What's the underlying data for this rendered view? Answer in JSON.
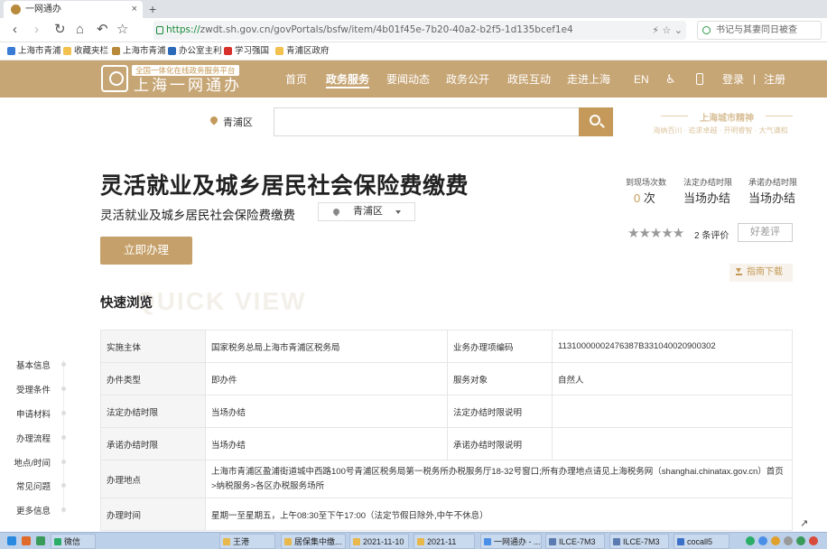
{
  "browser": {
    "tab_title": "一网通办",
    "tab_close": "×",
    "new_tab": "+",
    "url_scheme": "https://",
    "url_rest": "zwdt.sh.gov.cn/govPortals/bsfw/item/4b01f45e-7b20-40a2-b2f5-1d135bcef1e4",
    "url_right_icons": "⚡ ☆ ⌄",
    "search_placeholder": "书记与其妻同日被查",
    "bookmarks": [
      {
        "label": "上海市青浦",
        "color": "#3a7bd5"
      },
      {
        "label": "收藏夹栏",
        "color": "#f2c14e"
      },
      {
        "label": "上海市青浦",
        "color": "#b88a3c"
      },
      {
        "label": "办公室主利",
        "color": "#2a6ab8"
      },
      {
        "label": "学习强国",
        "color": "#d8302a"
      },
      {
        "label": "青浦区政府",
        "color": "#f2c14e"
      }
    ],
    "nav_back": "‹",
    "nav_forward": "›",
    "nav_reload": "↻",
    "nav_home": "⌂",
    "nav_undo": "↶",
    "nav_star": "☆"
  },
  "site": {
    "logo_tag": "全国一体化在线政务服务平台",
    "logo_name": "上海一网通办",
    "menu": [
      {
        "label": "首页",
        "active": false
      },
      {
        "label": "政务服务",
        "active": true
      },
      {
        "label": "要闻动态",
        "active": false
      },
      {
        "label": "政务公开",
        "active": false
      },
      {
        "label": "政民互动",
        "active": false
      },
      {
        "label": "走进上海",
        "active": false
      }
    ],
    "lang": "EN",
    "accessibility_icon": "♿",
    "login": "登录",
    "separator": "|",
    "register": "注册",
    "brand_color": "#c7a676",
    "accent_color": "#c49a56"
  },
  "search": {
    "location": "青浦区",
    "placeholder": "",
    "promo_title": "上海城市精神",
    "promo_sub": "海纳百川 · 追求卓越 · 开明睿智 · 大气谦和"
  },
  "item": {
    "title": "灵活就业及城乡居民社会保险费缴费",
    "subtitle": "灵活就业及城乡居民社会保险费缴费",
    "district": "青浦区",
    "stats": [
      {
        "label": "到现场次数",
        "num": "0",
        "unit": "次"
      },
      {
        "label": "法定办结时限",
        "value": "当场办结"
      },
      {
        "label": "承诺办结时限",
        "value": "当场办结"
      }
    ],
    "stars": "★★★★★",
    "rating_fraction": 1.0,
    "review_count": "2 条评价",
    "review_button": "好差评",
    "apply_button": "立即办理",
    "guide_button": "指南下载",
    "watermark": "QUICK VIEW",
    "quick_title": "快速浏览"
  },
  "side_nav": [
    "基本信息",
    "受理条件",
    "申请材料",
    "办理流程",
    "地点/时间",
    "常见问题",
    "更多信息"
  ],
  "table": {
    "rows": [
      {
        "l1": "实施主体",
        "v1": "国家税务总局上海市青浦区税务局",
        "l2": "业务办理项编码",
        "v2": "11310000002476387B331040020900302"
      },
      {
        "l1": "办件类型",
        "v1": "即办件",
        "l2": "服务对象",
        "v2": "自然人"
      },
      {
        "l1": "法定办结时限",
        "v1": "当场办结",
        "l2": "法定办结时限说明",
        "v2": ""
      },
      {
        "l1": "承诺办结时限",
        "v1": "当场办结",
        "l2": "承诺办结时限说明",
        "v2": ""
      }
    ],
    "address_label": "办理地点",
    "address_value": "上海市青浦区盈浦街道城中西路100号青浦区税务局第一税务所办税服务厅18-32号窗口;所有办理地点请见上海税务网（shanghai.chinatax.gov.cn）首页>纳税服务>各区办税服务场所",
    "hours_label": "办理时间",
    "hours_value": "星期一至星期五，上午08:30至下午17:00（法定节假日除外,中午不休息）"
  },
  "taskbar": {
    "items": [
      {
        "label": "微信",
        "color": "#2aae67"
      },
      {
        "label": "王港",
        "color": "#e8b84a"
      },
      {
        "label": "居保集中缴...",
        "color": "#e8b84a"
      },
      {
        "label": "2021-11-10",
        "color": "#e8b84a"
      },
      {
        "label": "2021-11",
        "color": "#e8b84a"
      },
      {
        "label": "一网通办 - ...",
        "color": "#4a8ee8"
      },
      {
        "label": "ILCE-7M3",
        "color": "#5a7ab0"
      },
      {
        "label": "ILCE-7M3",
        "color": "#5a7ab0"
      },
      {
        "label": "cocall5",
        "color": "#3a70c8"
      }
    ],
    "cursor": "↗"
  }
}
